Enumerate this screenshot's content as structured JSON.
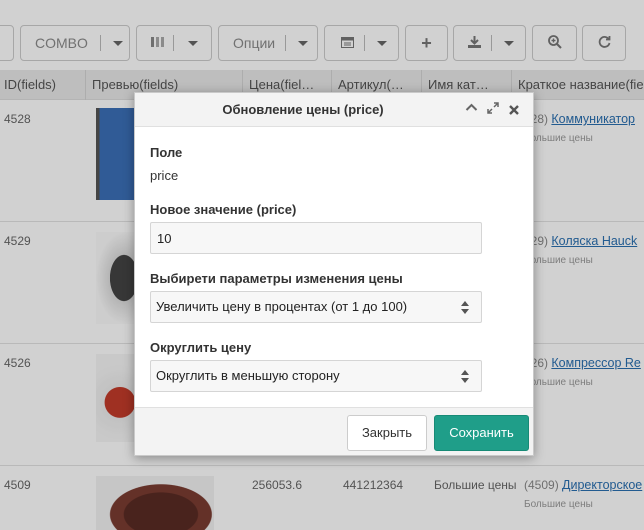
{
  "toolbar": {
    "combo_label": "COMBO",
    "options_label": "Опции"
  },
  "table": {
    "headers": [
      "ID(fields)",
      "Превью(fields)",
      "Цена(fiel…",
      "Артикул(…",
      "Имя кат…",
      "Краткое название(fie"
    ],
    "rows": [
      {
        "id": "4528",
        "price": "",
        "sku": "",
        "category": "",
        "code": "528)",
        "name": "Коммуникатор",
        "sub": "Большие цены"
      },
      {
        "id": "4529",
        "price": "",
        "sku": "",
        "category": "",
        "code": "529)",
        "name": "Коляска Hauck",
        "sub": "Большие цены"
      },
      {
        "id": "4526",
        "price": "",
        "sku": "",
        "category": "",
        "code": "526)",
        "name": "Компрессор Re",
        "sub": "Большие цены"
      },
      {
        "id": "4509",
        "price": "256053.6",
        "sku": "441212364",
        "category": "Большие цены",
        "code": "(4509)",
        "name": "Директорское",
        "sub": "Большие цены"
      }
    ]
  },
  "dialog": {
    "title": "Обновление цены (price)",
    "field_label": "Поле",
    "field_value": "price",
    "new_value_label": "Новое значение (price)",
    "new_value": "10",
    "params_label": "Выбирети параметры изменения цены",
    "params_selected": "Увеличить цену в процентах (от 1 до 100)",
    "round_label": "Округлить цену",
    "round_selected": "Округлить в меньшую сторону",
    "close_button": "Закрыть",
    "save_button": "Сохранить"
  },
  "colors": {
    "save_button": "#1f9e89",
    "link": "#2a6fb0",
    "header_bg": "#e8e8e8"
  }
}
